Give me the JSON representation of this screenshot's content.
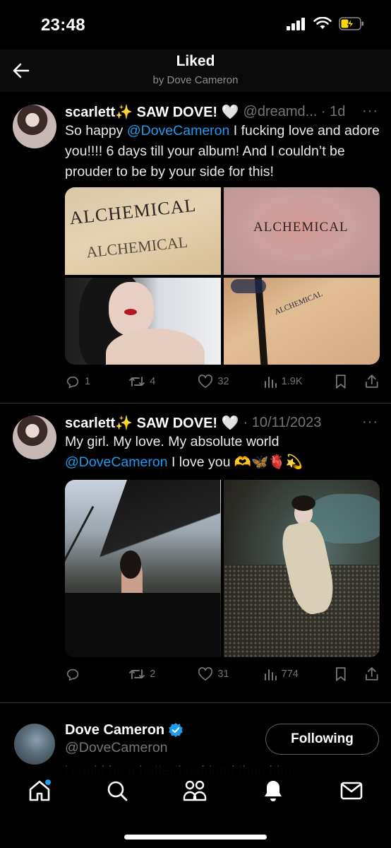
{
  "status_bar": {
    "time": "23:48",
    "icons": [
      "cellular-signal-icon",
      "wifi-icon",
      "battery-charging-icon"
    ]
  },
  "header": {
    "title": "Liked",
    "subtitle": "by Dove Cameron"
  },
  "tweets": [
    {
      "display_name": "scarlett✨ SAW DOVE! 🤍",
      "handle_time": "@dreamd... · 1d",
      "text_parts": [
        "So happy ",
        "@DoveCameron",
        " I fucking love and adore you!!!!  6 days till your album! And I couldn’t be prouder to be by your side for this!"
      ],
      "images": [
        {
          "icon": "tattoo-photo-icon",
          "caption": "ALCHEMICAL"
        },
        {
          "icon": "tattoo-photo-icon",
          "caption": "ALCHEMICAL"
        },
        {
          "icon": "portrait-photo-icon",
          "caption": ""
        },
        {
          "icon": "tattoo-photo-icon",
          "caption": "ALCHEMICAL"
        }
      ],
      "stats": {
        "replies": "1",
        "reposts": "4",
        "likes": "32",
        "views": "1.9K"
      }
    },
    {
      "display_name": "scarlett✨ SAW DOVE! 🤍",
      "handle_time": "· 10/11/2023",
      "text_parts": [
        "My girl. My love. My absolute world ",
        "@DoveCameron",
        " I love you 🫶🦋🫀💫"
      ],
      "images": [
        {
          "icon": "piano-photo-icon",
          "caption": ""
        },
        {
          "icon": "shore-photo-icon",
          "caption": ""
        }
      ],
      "stats": {
        "replies": "",
        "reposts": "2",
        "likes": "31",
        "views": "774"
      }
    }
  ],
  "follow_card": {
    "name": "Dove Cameron",
    "handle": "@DoveCameron",
    "button_label": "Following",
    "overlapping_text": "i could be a better boyfriend than him"
  },
  "colors": {
    "accent": "#1d9bf0",
    "muted": "#71767b",
    "background": "#000000"
  },
  "tabbar": {
    "items": [
      "home-icon",
      "search-icon",
      "communities-icon",
      "notifications-icon",
      "messages-icon"
    ]
  }
}
